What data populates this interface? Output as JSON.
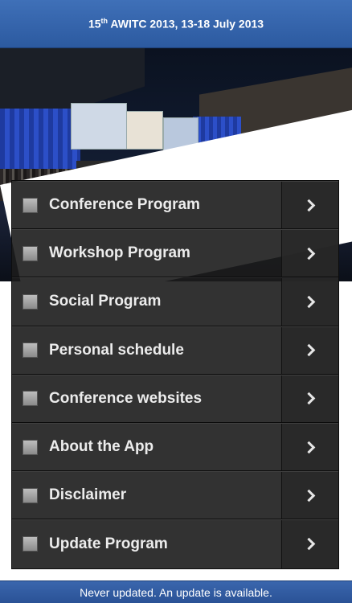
{
  "header": {
    "title_prefix": "15",
    "title_sup": "th",
    "title_rest": " AWITC 2013, 13-18 July 2013"
  },
  "menu": {
    "items": [
      {
        "label": "Conference Program"
      },
      {
        "label": "Workshop Program"
      },
      {
        "label": "Social Program"
      },
      {
        "label": "Personal schedule"
      },
      {
        "label": "Conference websites"
      },
      {
        "label": "About the App"
      },
      {
        "label": "Disclaimer"
      },
      {
        "label": "Update Program"
      }
    ]
  },
  "footer": {
    "status": "Never updated. An update is available."
  },
  "colors": {
    "header_blue": "#3f70b8",
    "menu_bg": "#1c1c1c",
    "footer_blue": "#2a5296"
  }
}
